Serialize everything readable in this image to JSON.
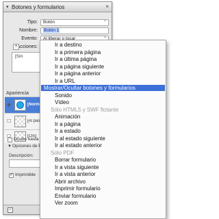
{
  "panel": {
    "title": "Botones y formularios",
    "title_arrow": "▾",
    "close_glyph": "×",
    "type_label": "Tipo:",
    "type_value": "Botón",
    "name_label": "Nombre:",
    "name_value": "Botón 1",
    "event_label": "Evento:",
    "event_value": "Al liberar o tocar",
    "actions_label": "Acciones:",
    "actions_box_text": "[Sin",
    "appearance_label": "Apariencia",
    "states": [
      {
        "label": "[Normal]",
        "selected": true
      },
      {
        "label": "[Al pasar",
        "selected": false
      },
      {
        "label": "[Clic]",
        "selected": false
      }
    ],
    "hidden_until_activated_label": "Oculto hasta activ",
    "pdf_options_label": "Opciones de PDF",
    "description_label": "Descripción:",
    "printable_label": "Imprimible",
    "dropdown_glyph": "⌃"
  },
  "menu": {
    "items": [
      {
        "label": "Ir a destino",
        "kind": "item"
      },
      {
        "label": "Ir a primera página",
        "kind": "item"
      },
      {
        "label": "Ir a última página",
        "kind": "item"
      },
      {
        "label": "Ir a página siguiente",
        "kind": "item"
      },
      {
        "label": "Ir a página anterior",
        "kind": "item"
      },
      {
        "label": "Ir a URL",
        "kind": "item"
      },
      {
        "label": "Mostrar/Ocultar botones y formularios",
        "kind": "highlighted"
      },
      {
        "label": "Sonido",
        "kind": "item"
      },
      {
        "label": "Vídeo",
        "kind": "item"
      },
      {
        "label": "Sólo HTML5 y SWF flotante",
        "kind": "section"
      },
      {
        "label": "Animación",
        "kind": "item"
      },
      {
        "label": "Ir a página",
        "kind": "item"
      },
      {
        "label": "Ir a estado",
        "kind": "item"
      },
      {
        "label": "Ir al estado siguiente",
        "kind": "item"
      },
      {
        "label": "Ir al estado anterior",
        "kind": "item"
      },
      {
        "label": "Sólo PDF",
        "kind": "section"
      },
      {
        "label": "Borrar formulario",
        "kind": "item"
      },
      {
        "label": "Ir a vista siguiente",
        "kind": "item"
      },
      {
        "label": "Ir a vista anterior",
        "kind": "item"
      },
      {
        "label": "Abrir archivo",
        "kind": "item"
      },
      {
        "label": "Imprimir formulario",
        "kind": "item"
      },
      {
        "label": "Enviar formulario",
        "kind": "item"
      },
      {
        "label": "Ver zoom",
        "kind": "item"
      }
    ]
  },
  "colors": {
    "highlight": "#3c6fd8",
    "state_selected": "#4a7fd8",
    "button_circle": "#27a7e8",
    "section_text": "#9a9a9a"
  }
}
